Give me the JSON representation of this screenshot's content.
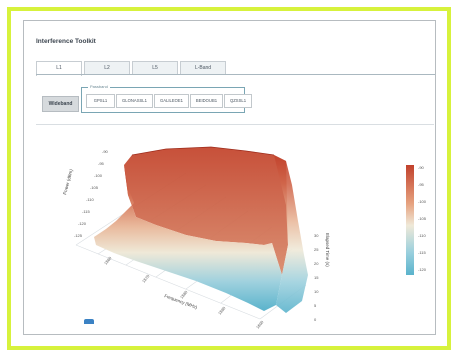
{
  "app": {
    "title": "Interference Toolkit"
  },
  "tabs": [
    "L1",
    "L2",
    "L5",
    "L-Band"
  ],
  "toolbar": {
    "wideband_label": "Wideband",
    "fieldset_legend": "Passband",
    "bands": [
      "GPSL1",
      "GLONASSL1",
      "GALILEOE1",
      "BEIDOUB1",
      "QZSSL1"
    ]
  },
  "plot": {
    "y_axis_label": "Power (dBm)",
    "x_axis_label": "Frequency (MHz)",
    "z_axis_label": "Elapsed Time (s)",
    "y_ticks": [
      "-90",
      "-95",
      "-100",
      "-105",
      "-110",
      "-115",
      "-120",
      "-125"
    ],
    "x_ticks": [
      "1560",
      "1570",
      "1580",
      "1590",
      "1600"
    ],
    "z_ticks": [
      "30",
      "25",
      "20",
      "15",
      "10",
      "5",
      "0"
    ],
    "colorbar_ticks": [
      "-90",
      "-95",
      "-100",
      "-105",
      "-110",
      "-115",
      "-120"
    ],
    "colors": {
      "high": "#c1412c",
      "mid": "#efe9d8",
      "low": "#5ab3cc"
    }
  }
}
